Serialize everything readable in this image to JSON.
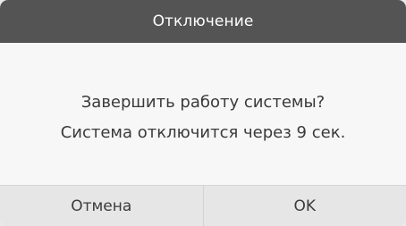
{
  "dialog": {
    "title": "Отключение",
    "message_line1": "Завершить работу системы?",
    "message_line2": "Система отключится через 9 сек.",
    "cancel_label": "Отмена",
    "ok_label": "OK"
  },
  "colors": {
    "titlebar": "#545454",
    "body": "#f7f7f7",
    "footer": "#e6e6e6",
    "text": "#3a3a3a"
  }
}
